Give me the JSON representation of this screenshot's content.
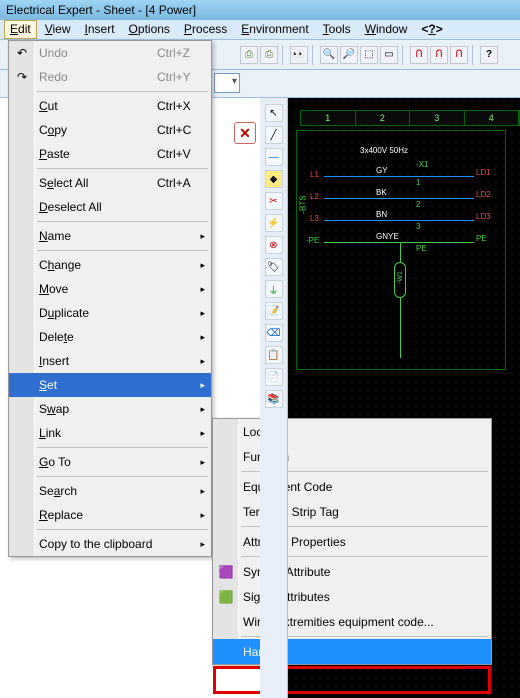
{
  "app_title": "Electrical Expert - Sheet - [4 Power]",
  "menubar": [
    "Edit",
    "View",
    "Insert",
    "Options",
    "Process",
    "Environment",
    "Tools",
    "Window",
    "<?>"
  ],
  "menubar_accel": [
    "E",
    "V",
    "I",
    "O",
    "P",
    "E",
    "T",
    "W",
    ""
  ],
  "edit_menu": {
    "undo": {
      "label": "Undo",
      "short": "Ctrl+Z",
      "icon": "↶"
    },
    "redo": {
      "label": "Redo",
      "short": "Ctrl+Y",
      "icon": "↷"
    },
    "cut": {
      "label": "Cut",
      "short": "Ctrl+X"
    },
    "copy": {
      "label": "Copy",
      "short": "Ctrl+C"
    },
    "paste": {
      "label": "Paste",
      "short": "Ctrl+V"
    },
    "select_all": {
      "label": "Select All",
      "short": "Ctrl+A"
    },
    "deselect_all": {
      "label": "Deselect All",
      "short": ""
    },
    "name": {
      "label": "Name"
    },
    "change": {
      "label": "Change"
    },
    "move": {
      "label": "Move"
    },
    "duplicate": {
      "label": "Duplicate"
    },
    "delete": {
      "label": "Delete"
    },
    "insert": {
      "label": "Insert"
    },
    "set": {
      "label": "Set"
    },
    "swap": {
      "label": "Swap"
    },
    "link": {
      "label": "Link"
    },
    "goto": {
      "label": "Go To"
    },
    "search": {
      "label": "Search"
    },
    "replace": {
      "label": "Replace"
    },
    "copy_clip": {
      "label": "Copy to the clipboard"
    }
  },
  "set_submenu": {
    "location": "Location",
    "function": "Function",
    "equipment_code": "Equipment Code",
    "terminal_strip_tag": "Terminal Strip Tag",
    "attribute_properties": "Attribute Properties",
    "symbol_attribute": "Symbol Attribute",
    "signal_attributes": "Signal Attributes",
    "wires_ext": "Wires extremities equipment code...",
    "harness": "Harness"
  },
  "ruler_cells": [
    "1",
    "2",
    "3",
    "4"
  ],
  "schematic": {
    "power_text": "3x400V 50Hz",
    "phases": [
      "L1",
      "L2",
      "L3",
      "-PE"
    ],
    "bus_label": "-BTS",
    "terminal": "-X1",
    "nums": [
      "1",
      "2",
      "3"
    ],
    "bk_labels": [
      "GY",
      "BK",
      "BN",
      "GNYE"
    ],
    "right_labels": [
      "LD1",
      "LD2",
      "LD3",
      "PE"
    ],
    "pe": "PE",
    "oval_label": "-W1"
  },
  "sub_arrow": "▸"
}
